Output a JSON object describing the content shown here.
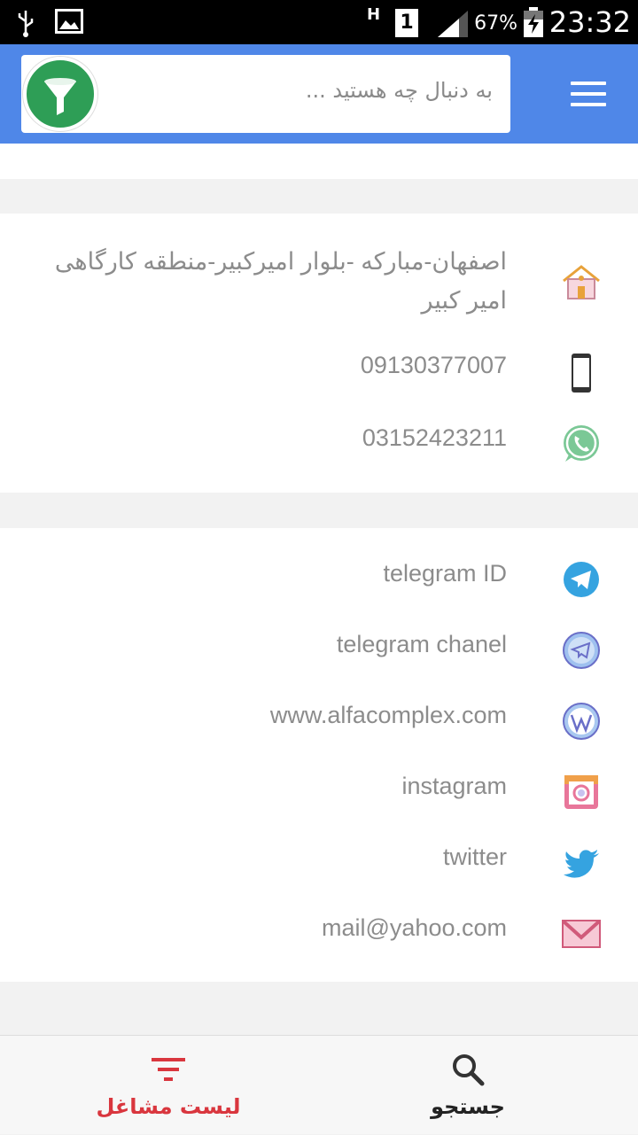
{
  "status_bar": {
    "battery": "67%",
    "time": "23:32",
    "network": "H",
    "sim": "1"
  },
  "search": {
    "placeholder": "به دنبال چه هستید ..."
  },
  "contact": {
    "address": "اصفهان-مبارکه -بلوار امیرکبیر-منطقه کارگاهی امیر کبیر",
    "mobile": "09130377007",
    "phone": "03152423211"
  },
  "links": {
    "telegram_id": "telegram ID",
    "telegram_channel": "telegram chanel",
    "website": "www.alfacomplex.com",
    "instagram": "instagram",
    "twitter": "twitter",
    "email": "mail@yahoo.com"
  },
  "bottom_nav": {
    "jobs_label": "لیست مشاغل",
    "search_label": "جستجو",
    "active_color": "#d9363e"
  },
  "colors": {
    "app_bar": "#4f87e8",
    "filter_button": "#2e9e56"
  }
}
